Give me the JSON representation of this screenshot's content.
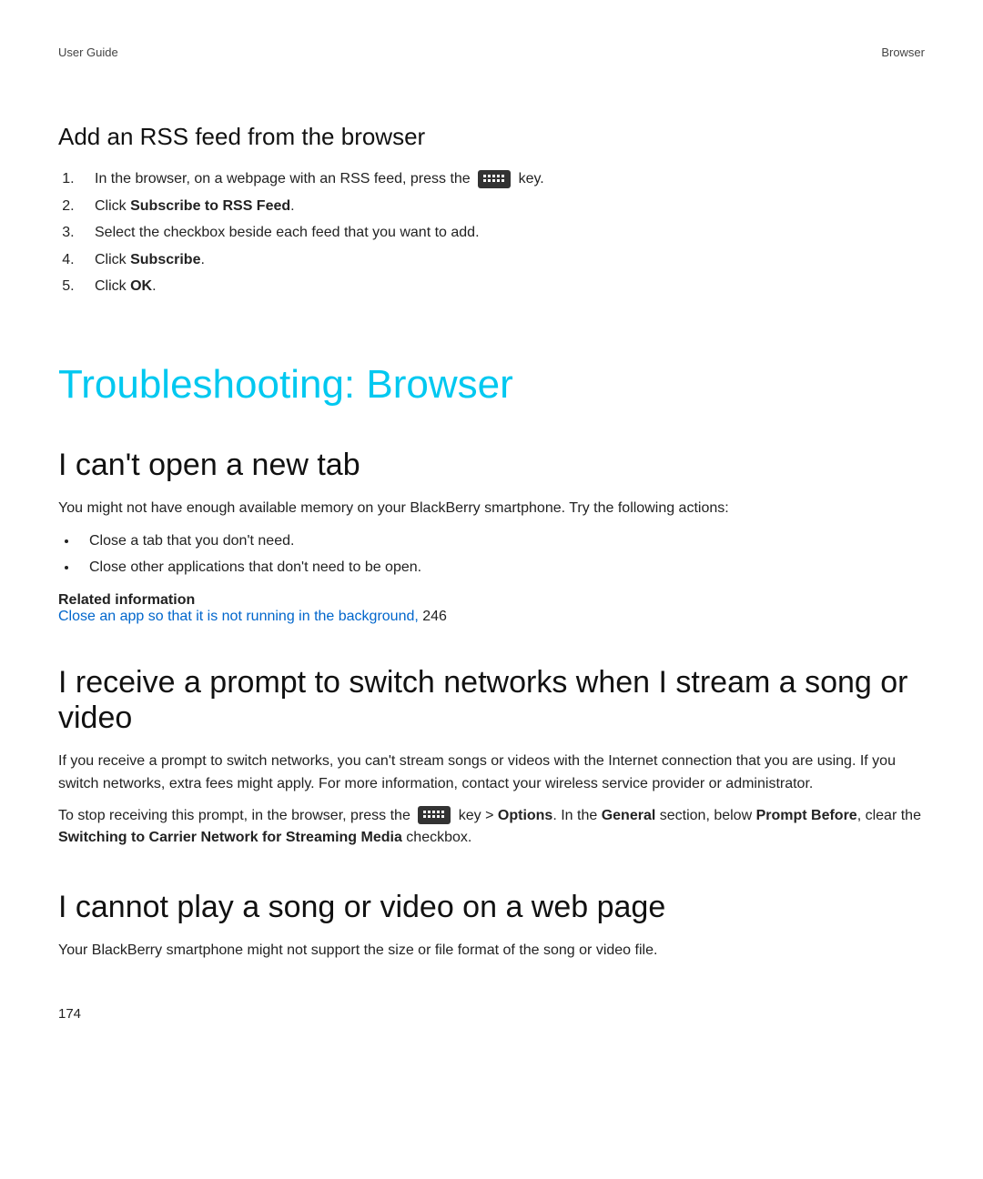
{
  "header": {
    "left": "User Guide",
    "right": "Browser"
  },
  "rss": {
    "heading": "Add an RSS feed from the browser",
    "step1_before": "In the browser, on a webpage with an RSS feed, press the ",
    "step1_after": " key.",
    "step2_before": "Click ",
    "step2_bold": "Subscribe to RSS Feed",
    "step2_after": ".",
    "step3": "Select the checkbox beside each feed that you want to add.",
    "step4_before": "Click ",
    "step4_bold": "Subscribe",
    "step4_after": ".",
    "step5_before": "Click ",
    "step5_bold": "OK",
    "step5_after": "."
  },
  "main_heading": "Troubleshooting: Browser",
  "tab": {
    "heading": "I can't open a new tab",
    "intro": "You might not have enough available memory on your BlackBerry smartphone. Try the following actions:",
    "bullet1": "Close a tab that you don't need.",
    "bullet2": "Close other applications that don't need to be open.",
    "related_title": "Related information",
    "related_link": "Close an app so that it is not running in the background,",
    "related_page": " 246"
  },
  "stream": {
    "heading": "I receive a prompt to switch networks when I stream a song or video",
    "p1": "If you receive a prompt to switch networks, you can't stream songs or videos with the Internet connection that you are using. If you switch networks, extra fees might apply. For more information, contact your wireless service provider or administrator.",
    "p2_before": "To stop receiving this prompt, in the browser, press the ",
    "p2_mid1": " key > ",
    "p2_bold1": "Options",
    "p2_mid2": ". In the ",
    "p2_bold2": "General",
    "p2_mid3": " section, below ",
    "p2_bold3": "Prompt Before",
    "p2_mid4": ", clear the ",
    "p2_bold4": "Switching to Carrier Network for Streaming Media",
    "p2_after": " checkbox."
  },
  "play": {
    "heading": "I cannot play a song or video on a web page",
    "p1": "Your BlackBerry smartphone might not support the size or file format of the song or video file."
  },
  "page_number": "174"
}
